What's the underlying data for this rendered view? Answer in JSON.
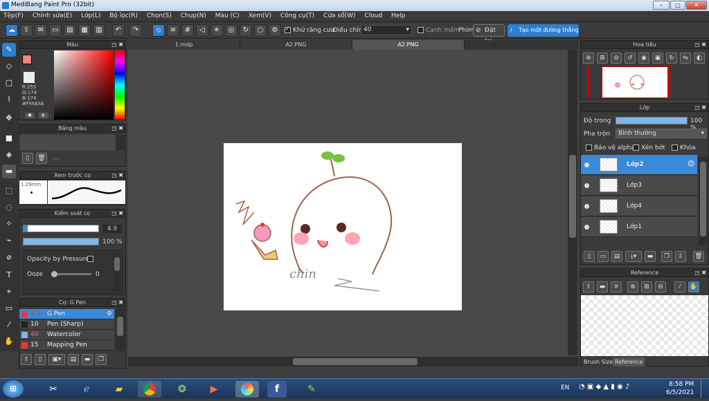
{
  "window": {
    "title": "MediBang Paint Pro (32bit)",
    "min": "–",
    "max": "□",
    "close": "✕"
  },
  "menu": [
    "Tệp(F)",
    "Chỉnh sửa(E)",
    "Lớp(L)",
    "Bộ lọc(R)",
    "Chọn(S)",
    "Chụp(N)",
    "Màu (C)",
    "Xem(V)",
    "Công cụ(T)",
    "Cửa sổ(W)",
    "Cloud",
    "Help"
  ],
  "toolbar": {
    "antialias_label": "Khử răng cưa",
    "adjust_label": "Điều chỉnh",
    "adjust_value": "40",
    "snap_label": "Cạnh mềm",
    "phim_label": "Phim",
    "reset_label": "Đặt lại",
    "create_line_label": "Tạo một đường thẳng"
  },
  "color_panel": {
    "title": "Màu",
    "r": "R:255",
    "g": "G:174",
    "b": "B:174",
    "hex": "#FFAEAE",
    "fg": "#ff8080",
    "bg": "#ffffff"
  },
  "palette_panel": {
    "title": "Bảng màu",
    "dash": "---"
  },
  "brush_preview": {
    "title": "Xem trước cọ",
    "size": "1.29mm"
  },
  "brush_control": {
    "title": "Kiểm soát cọ",
    "size_value": "4.9",
    "opacity_value": "100 %",
    "opacity_pressure": "Opacity by Pressure",
    "ooze_label": "Ooze",
    "ooze_value": "0",
    "opacity": 1.0
  },
  "brush_list": {
    "title": "Cọ: G Pen",
    "items": [
      {
        "size": "4.9",
        "name": "G Pen",
        "color": "#e23b3b"
      },
      {
        "size": "10",
        "name": "Pen (Sharp)",
        "color": "#222222"
      },
      {
        "size": "40",
        "name": "Watercolor",
        "color": "#7fb7e8"
      },
      {
        "size": "15",
        "name": "Mapping Pen",
        "color": "#e23b3b"
      }
    ]
  },
  "tabs": [
    "1.mdp",
    "A2.PNG",
    "A2.PNG"
  ],
  "canvas": {
    "signature": "chin"
  },
  "navigator": {
    "title": "Hoa tiêu"
  },
  "layer_panel": {
    "title": "Lớp",
    "opacity_label": "Độ trong",
    "opacity_value": "100 %",
    "opacity": 1.0,
    "blend_label": "Pha trộn",
    "blend_value": "Bình thường",
    "protect_alpha": "Bảo vệ alpha",
    "clipping": "Xén bớt",
    "lock": "Khóa",
    "layers": [
      "Lớp2",
      "Lớp3",
      "Lớp4",
      "Lớp1"
    ]
  },
  "reference_panel": {
    "title": "Reference",
    "tab_brush_size": "Brush Size",
    "tab_reference": "Reference"
  },
  "taskbar": {
    "lang": "EN",
    "time": "8:58 PM",
    "date": "6/5/2021"
  }
}
